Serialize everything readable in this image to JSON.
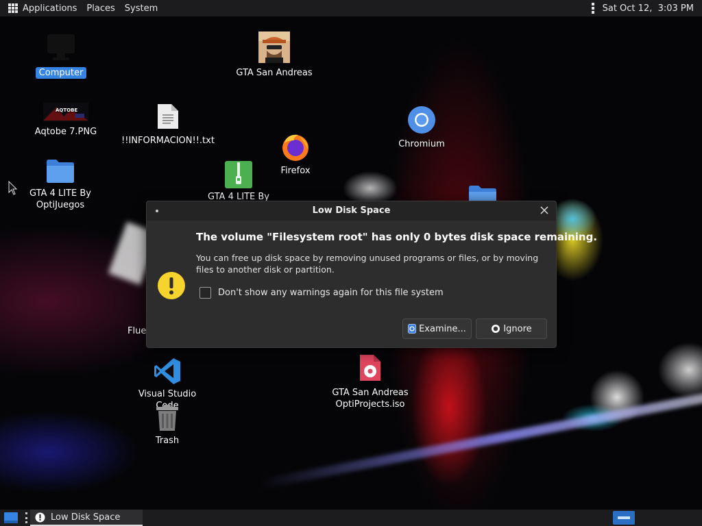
{
  "top_panel": {
    "menus": [
      "Applications",
      "Places",
      "System"
    ],
    "clock": "Sat Oct 12,  3:03 PM"
  },
  "desktop": {
    "icons": [
      {
        "label": "Computer",
        "icon": "computer-icon",
        "selected": true
      },
      {
        "label": "GTA San Andreas",
        "icon": "gta-avatar-icon"
      },
      {
        "label": "Aqtobe 7.PNG",
        "icon": "image-file-icon"
      },
      {
        "label": "!!INFORMACION!!.txt",
        "icon": "text-file-icon"
      },
      {
        "label": "Chromium",
        "icon": "chromium-icon"
      },
      {
        "label": "Firefox",
        "icon": "firefox-icon"
      },
      {
        "label": "GTA 4 LITE By OptiJuegos",
        "icon": "folder-icon"
      },
      {
        "label": "GTA 4 LITE By",
        "icon": "archive-file-icon"
      },
      {
        "label": "Flue",
        "icon": "partial-icon"
      },
      {
        "label": "Visual Studio Code",
        "icon": "vscode-icon"
      },
      {
        "label": "GTA San Andreas OptiProjects.iso",
        "icon": "disc-image-icon"
      },
      {
        "label": "Trash",
        "icon": "trash-icon"
      }
    ]
  },
  "dialog": {
    "title": "Low Disk Space",
    "heading": "The volume \"Filesystem root\" has only 0 bytes disk space remaining.",
    "body": "You can free up disk space by removing unused programs or files, or by moving files to another disk or partition.",
    "checkbox_label": "Don't show any warnings again for this file system",
    "checkbox_checked": false,
    "examine_label": "Examine...",
    "ignore_label": "Ignore",
    "icon": "warning-icon",
    "accent_color": "#f6d32d"
  },
  "bottom_panel": {
    "task_title": "Low Disk Space"
  },
  "colors": {
    "panel": "#1c1c1e",
    "selection": "#3584e4",
    "dialog_bg": "#2d2d2d"
  }
}
